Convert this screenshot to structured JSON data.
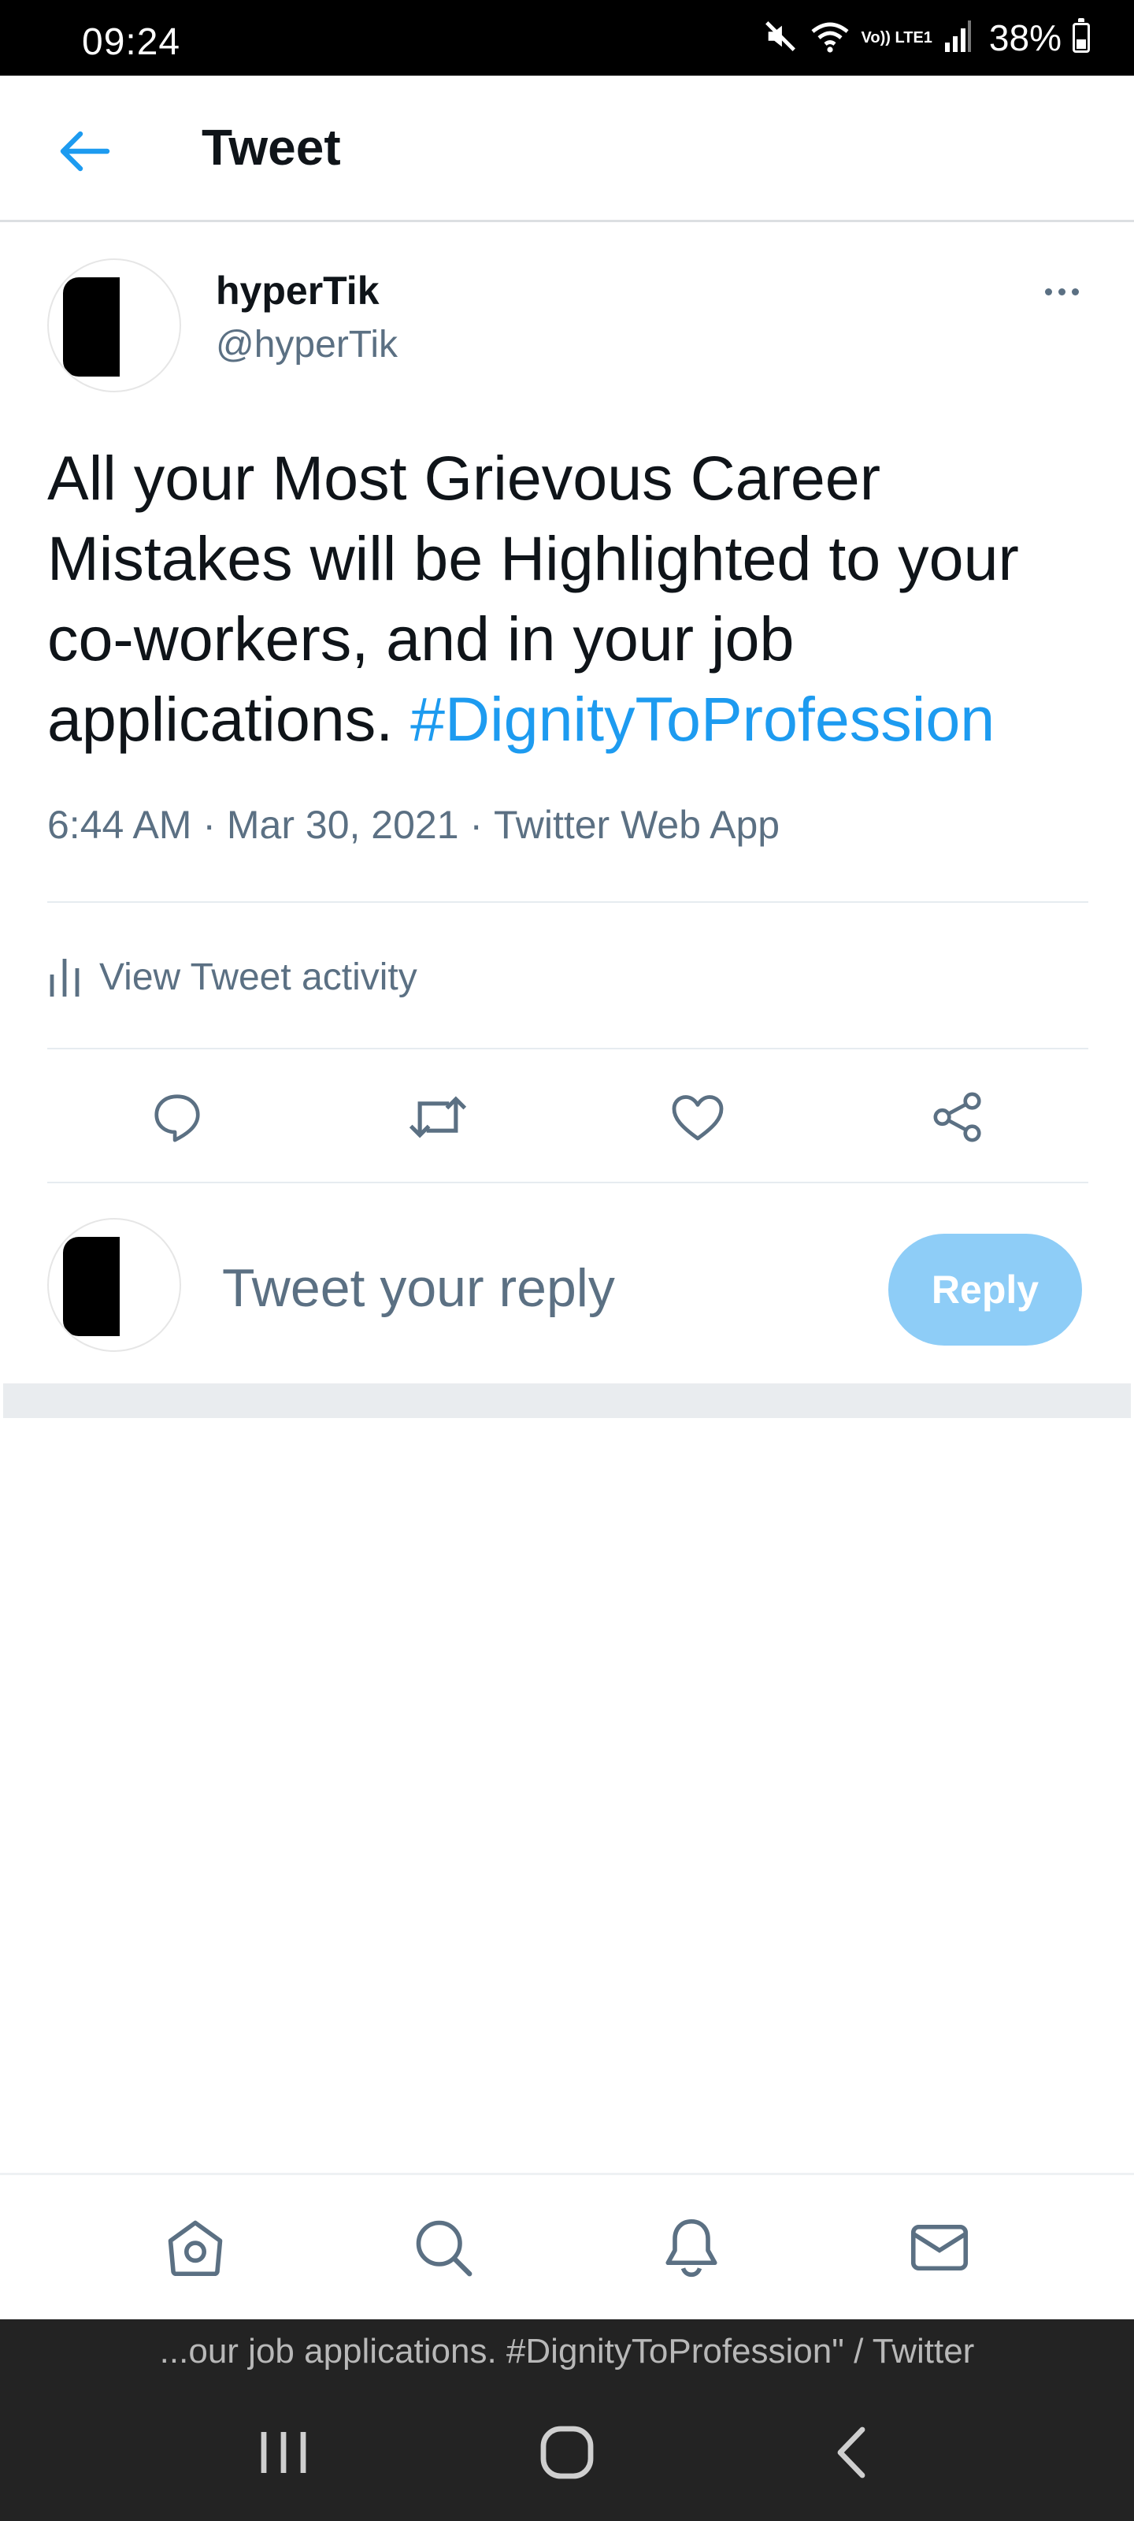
{
  "status_bar": {
    "time": "09:24",
    "lte_label": "Vo)) LTE1",
    "battery": "38%",
    "battery_level": 0.38
  },
  "header": {
    "title": "Tweet"
  },
  "tweet": {
    "author_name": "hyperTik",
    "author_handle": "@hyperTik",
    "text": "All your Most Grievous Career Mistakes will be Highlighted to your co-workers, and in your job applications. ",
    "hashtag": "#DignityToProfession",
    "time": "6:44 AM",
    "date": "Mar 30, 2021",
    "source": "Twitter Web App",
    "separator": " · ",
    "activity_label": "View Tweet activity"
  },
  "reply": {
    "placeholder": "Tweet your reply",
    "button_label": "Reply"
  },
  "browser": {
    "page_title": "...our job applications. #DignityToProfession\" / Twitter"
  },
  "colors": {
    "accent": "#1d9bf0",
    "secondary_text": "#5b7083",
    "reply_button": "#8ecdf7"
  },
  "icons": {
    "back": "arrow-left-icon",
    "more": "more-dots-icon",
    "activity": "bar-chart-icon",
    "reply": "comment-icon",
    "retweet": "retweet-icon",
    "like": "heart-icon",
    "share": "share-icon",
    "home": "home-icon",
    "search": "search-icon",
    "notifications": "bell-icon",
    "messages": "mail-icon"
  }
}
